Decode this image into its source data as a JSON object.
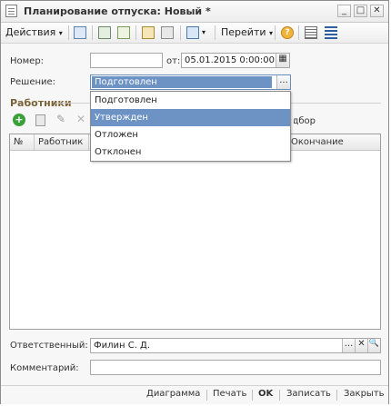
{
  "window": {
    "title": "Планирование отпуска: Новый *"
  },
  "toolbar": {
    "actions_label": "Действия",
    "goto_label": "Перейти"
  },
  "form": {
    "number_label": "Номер:",
    "number_value": "",
    "date_from_label": "от:",
    "date_value": "05.01.2015  0:00:00",
    "decision_label": "Решение:",
    "decision_value": "Подготовлен"
  },
  "decision_options": [
    "Подготовлен",
    "Утвержден",
    "Отложен",
    "Отклонен"
  ],
  "decision_highlighted": "Утвержден",
  "workers": {
    "section_title": "Работники",
    "selection_label": "Подбор",
    "columns": [
      "№",
      "Работник",
      "Окончание"
    ],
    "rows": []
  },
  "footer_fields": {
    "responsible_label": "Ответственный:",
    "responsible_value": "Филин С. Д.",
    "comment_label": "Комментарий:",
    "comment_value": ""
  },
  "statusbar": {
    "diagram": "Диаграмма",
    "print": "Печать",
    "ok": "OK",
    "save": "Записать",
    "close": "Закрыть"
  },
  "colors": {
    "accent_selected": "#6d93c5",
    "section_title": "#7a6437",
    "add_icon": "#3aa03a"
  }
}
